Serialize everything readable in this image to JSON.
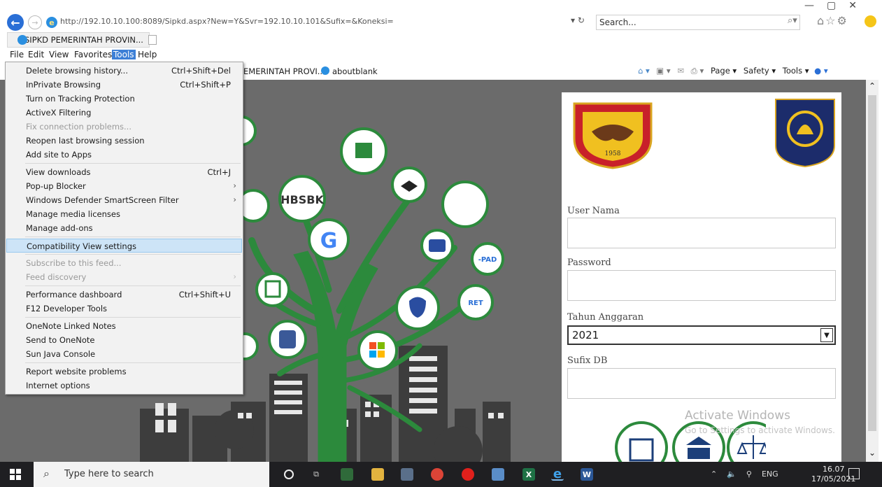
{
  "browser": {
    "address": "http://192.10.10.100:8089/Sipkd.aspx?New=Y&Svr=192.10.10.101&Sufix=&Koneksi=",
    "address_host": "192.10.10.100",
    "search_placeholder": "Search...",
    "tab_title": "SIPKD PEMERINTAH PROVIN...",
    "tab_close": "×"
  },
  "menubar": [
    "File",
    "Edit",
    "View",
    "Favorites",
    "Tools",
    "Help"
  ],
  "favorites": {
    "item1": "EMERINTAH PROVI...",
    "item2": "aboutblank"
  },
  "command_bar": {
    "page": "Page ▾",
    "safety": "Safety ▾",
    "tools": "Tools ▾"
  },
  "tools_menu": [
    {
      "label": "Delete browsing history...",
      "shortcut": "Ctrl+Shift+Del"
    },
    {
      "label": "InPrivate Browsing",
      "shortcut": "Ctrl+Shift+P"
    },
    {
      "label": "Turn on Tracking Protection"
    },
    {
      "label": "ActiveX Filtering"
    },
    {
      "label": "Fix connection problems...",
      "disabled": true
    },
    {
      "label": "Reopen last browsing session"
    },
    {
      "label": "Add site to Apps"
    },
    {
      "label": "View downloads",
      "shortcut": "Ctrl+J"
    },
    {
      "label": "Pop-up Blocker",
      "submenu": true
    },
    {
      "label": "Windows Defender SmartScreen Filter",
      "submenu": true
    },
    {
      "label": "Manage media licenses"
    },
    {
      "label": "Manage add-ons"
    },
    {
      "label": "Compatibility View settings",
      "highlighted": true
    },
    {
      "label": "Subscribe to this feed...",
      "disabled": true
    },
    {
      "label": "Feed discovery",
      "disabled": true,
      "submenu": true
    },
    {
      "label": "Performance dashboard",
      "shortcut": "Ctrl+Shift+U"
    },
    {
      "label": "F12 Developer Tools"
    },
    {
      "label": "OneNote Linked Notes"
    },
    {
      "label": "Send to OneNote"
    },
    {
      "label": "Sun Java Console"
    },
    {
      "label": "Report website problems"
    },
    {
      "label": "Internet options"
    }
  ],
  "tree_apps": [
    "HBSBK",
    "G",
    "-PAD",
    "RET"
  ],
  "login": {
    "user_label": "User Nama",
    "password_label": "Password",
    "tahun_label": "Tahun Anggaran",
    "tahun_value": "2021",
    "sufix_label": "Sufix DB",
    "logo_year": "1958"
  },
  "watermark": {
    "title": "Activate Windows",
    "subtitle": "Go to Settings to activate Windows."
  },
  "taskbar": {
    "search_placeholder": "Type here to search",
    "lang": "ENG",
    "time": "16.07",
    "date": "17/05/2021"
  },
  "colors": {
    "highlight": "#cde4f7",
    "tools_menu_active": "#3c7fd6",
    "tree_green": "#2c8a3c",
    "content_bg": "#6b6b6b"
  }
}
